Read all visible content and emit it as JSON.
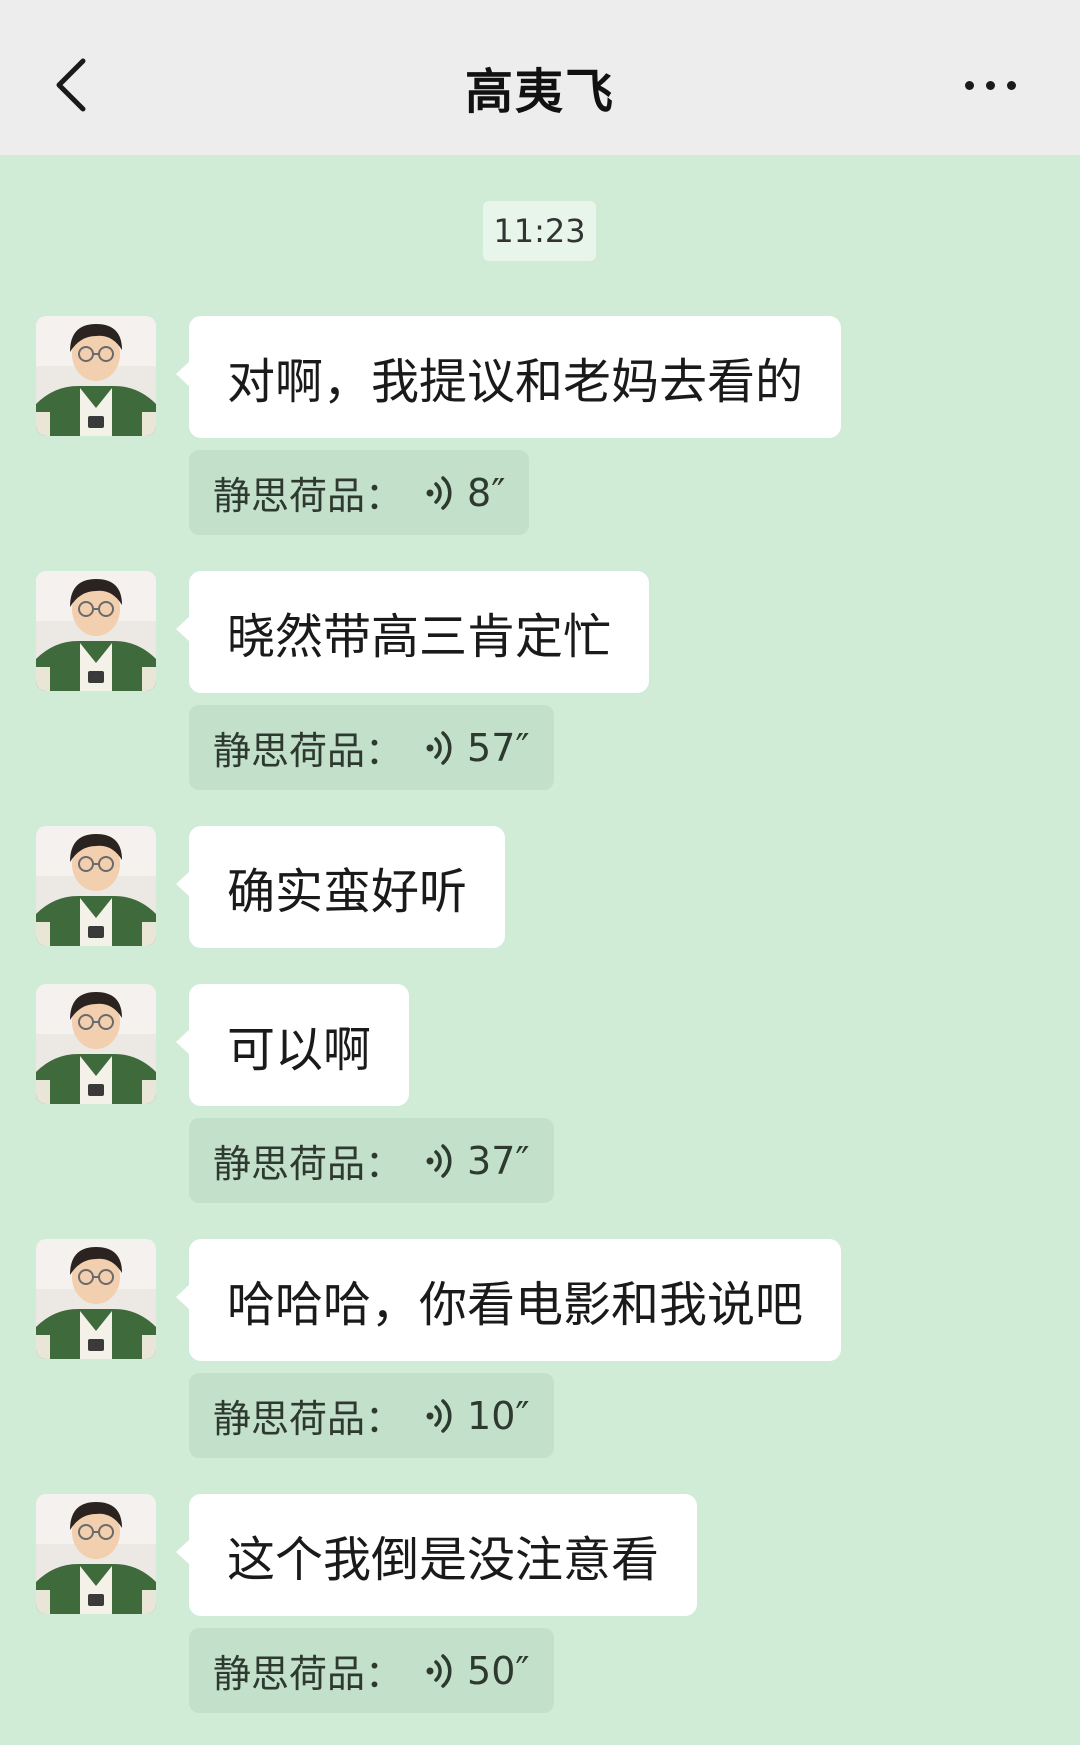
{
  "header": {
    "title": "高夷飞",
    "back_icon": "chevron-left-icon",
    "more_icon": "more-horizontal-icon"
  },
  "timestamp": "11:23",
  "colors": {
    "chat_background": "#d0ecd6",
    "header_background": "#ededed",
    "bubble_background": "#ffffff",
    "voice_card_background": "#c2e0ca"
  },
  "messages": [
    {
      "text": "对啊，我提议和老妈去看的",
      "voice": {
        "label": "静思荷品：",
        "duration": "8″"
      }
    },
    {
      "text": "晓然带高三肯定忙",
      "voice": {
        "label": "静思荷品：",
        "duration": "57″"
      }
    },
    {
      "text": "确实蛮好听"
    },
    {
      "text": "可以啊",
      "voice": {
        "label": "静思荷品：",
        "duration": "37″"
      }
    },
    {
      "text": "哈哈哈，你看电影和我说吧",
      "voice": {
        "label": "静思荷品：",
        "duration": "10″"
      }
    },
    {
      "text": "这个我倒是没注意看",
      "voice": {
        "label": "静思荷品：",
        "duration": "50″"
      }
    }
  ]
}
